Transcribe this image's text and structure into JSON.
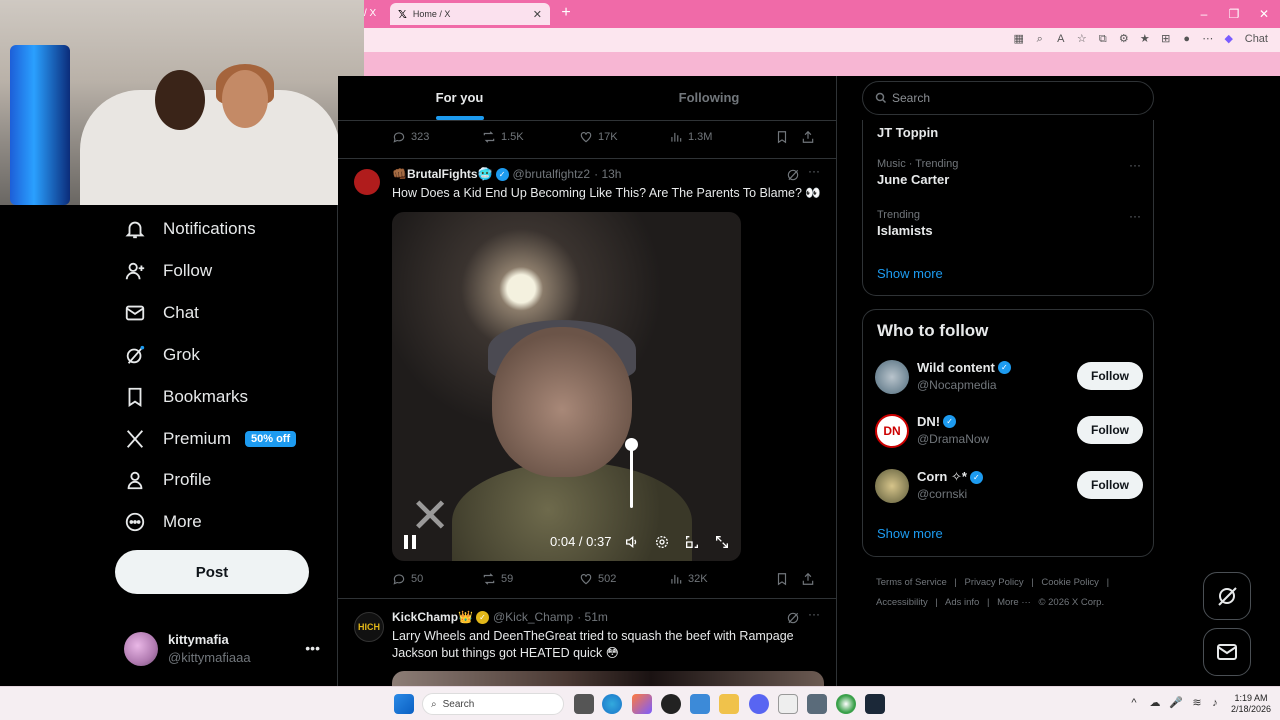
{
  "browser": {
    "prev_tab_label": "/ X",
    "active_tab_title": "Home / X",
    "new_tab_label": "+",
    "chat_label": "Chat"
  },
  "nav": {
    "items": [
      {
        "label": "Notifications",
        "icon": "bell-icon"
      },
      {
        "label": "Follow",
        "icon": "person-plus-icon"
      },
      {
        "label": "Chat",
        "icon": "envelope-icon"
      },
      {
        "label": "Grok",
        "icon": "grok-icon"
      },
      {
        "label": "Bookmarks",
        "icon": "bookmark-icon"
      },
      {
        "label": "Premium",
        "icon": "x-logo-icon",
        "badge": "50% off"
      },
      {
        "label": "Profile",
        "icon": "person-icon"
      },
      {
        "label": "More",
        "icon": "more-circle-icon"
      }
    ],
    "post_label": "Post",
    "account": {
      "name": "kittymafia",
      "handle": "@kittymafiaaa"
    }
  },
  "feed": {
    "tabs": [
      "For you",
      "Following"
    ],
    "active_tab": "For you",
    "prev_actions": {
      "replies": "323",
      "reposts": "1.5K",
      "likes": "17K",
      "views": "1.3M"
    },
    "tweets": [
      {
        "name": "👊🏾BrutalFights🥶",
        "handle": "@brutalfightz2",
        "time": "· 13h",
        "text": "How Does a Kid End Up Becoming Like This? Are The Parents To Blame? 👀",
        "video": {
          "time": "0:04 / 0:37",
          "volume": 0.85
        },
        "actions": {
          "replies": "50",
          "reposts": "59",
          "likes": "502",
          "views": "32K"
        }
      },
      {
        "name": "KickChamp👑",
        "handle": "@Kick_Champ",
        "time": "· 51m",
        "text": "Larry Wheels and DeenTheGreat tried to squash the beef with Rampage Jackson but things got HEATED quick 😳",
        "avatar_text": "HICH"
      }
    ]
  },
  "sidebar": {
    "search_placeholder": "Search",
    "trends": [
      {
        "context": "",
        "topic": "JT Toppin"
      },
      {
        "context": "Music · Trending",
        "topic": "June Carter"
      },
      {
        "context": "Trending",
        "topic": "Islamists"
      }
    ],
    "trends_show_more": "Show more",
    "who_to_follow_title": "Who to follow",
    "who_to_follow": [
      {
        "name": "Wild content",
        "handle": "@Nocapmedia",
        "button": "Follow"
      },
      {
        "name": "DN!",
        "handle": "@DramaNow",
        "button": "Follow",
        "avatar_text": "DN"
      },
      {
        "name": "Corn ✧*",
        "handle": "@cornski",
        "button": "Follow"
      }
    ],
    "wtf_show_more": "Show more",
    "footer": [
      "Terms of Service",
      "|",
      "Privacy Policy",
      "|",
      "Cookie Policy",
      "|",
      "Accessibility",
      "|",
      "Ads info",
      "|",
      "More ···",
      "© 2026 X Corp."
    ]
  },
  "taskbar": {
    "search_label": "Search",
    "time": "1:19 AM",
    "date": "2/18/2026"
  },
  "colors": {
    "accent": "#1d9bf0",
    "tabbar": "#f06aa8",
    "background": "#000000"
  }
}
